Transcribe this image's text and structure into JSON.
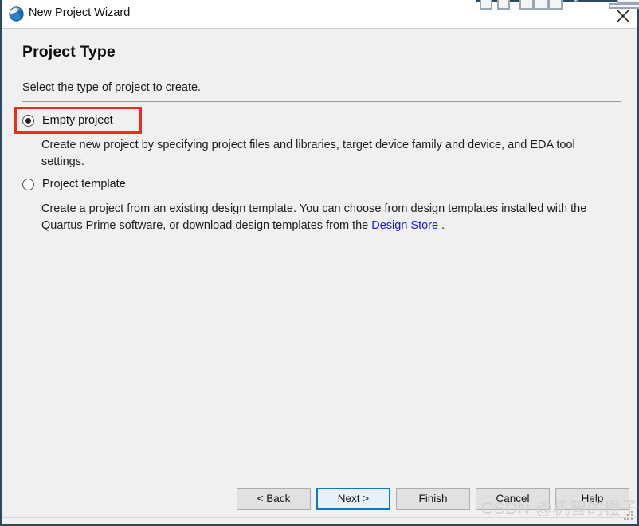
{
  "window": {
    "title": "New Project Wizard",
    "title_icon": "globe-icon",
    "close_icon": "close-icon",
    "border_color": "#2b4a5e"
  },
  "page": {
    "title": "Project Type",
    "subtitle": "Select the type of project to create."
  },
  "options": [
    {
      "id": "empty-project",
      "label": "Empty project",
      "selected": true,
      "highlighted": true,
      "highlight_color": "#ee2b23",
      "description": "Create new project by specifying project files and libraries, target device family and device, and EDA tool settings."
    },
    {
      "id": "project-template",
      "label": "Project template",
      "selected": false,
      "highlighted": false,
      "description_before_link": "Create a project from an existing design template. You can choose from design templates installed with the Quartus Prime software, or download design templates from the ",
      "link_text": "Design Store",
      "link_color": "#1818e8",
      "description_after_link": "."
    }
  ],
  "footer": {
    "buttons": [
      {
        "id": "back",
        "label": "< Back",
        "primary": false
      },
      {
        "id": "next",
        "label": "Next >",
        "primary": true
      },
      {
        "id": "finish",
        "label": "Finish",
        "primary": false
      },
      {
        "id": "cancel",
        "label": "Cancel",
        "primary": false
      },
      {
        "id": "help",
        "label": "Help",
        "primary": false
      }
    ],
    "primary_button_accent": "#0a7ac4"
  },
  "watermark": {
    "text": "CSDN @机智的橙子",
    "color": "#d2d2d2"
  }
}
